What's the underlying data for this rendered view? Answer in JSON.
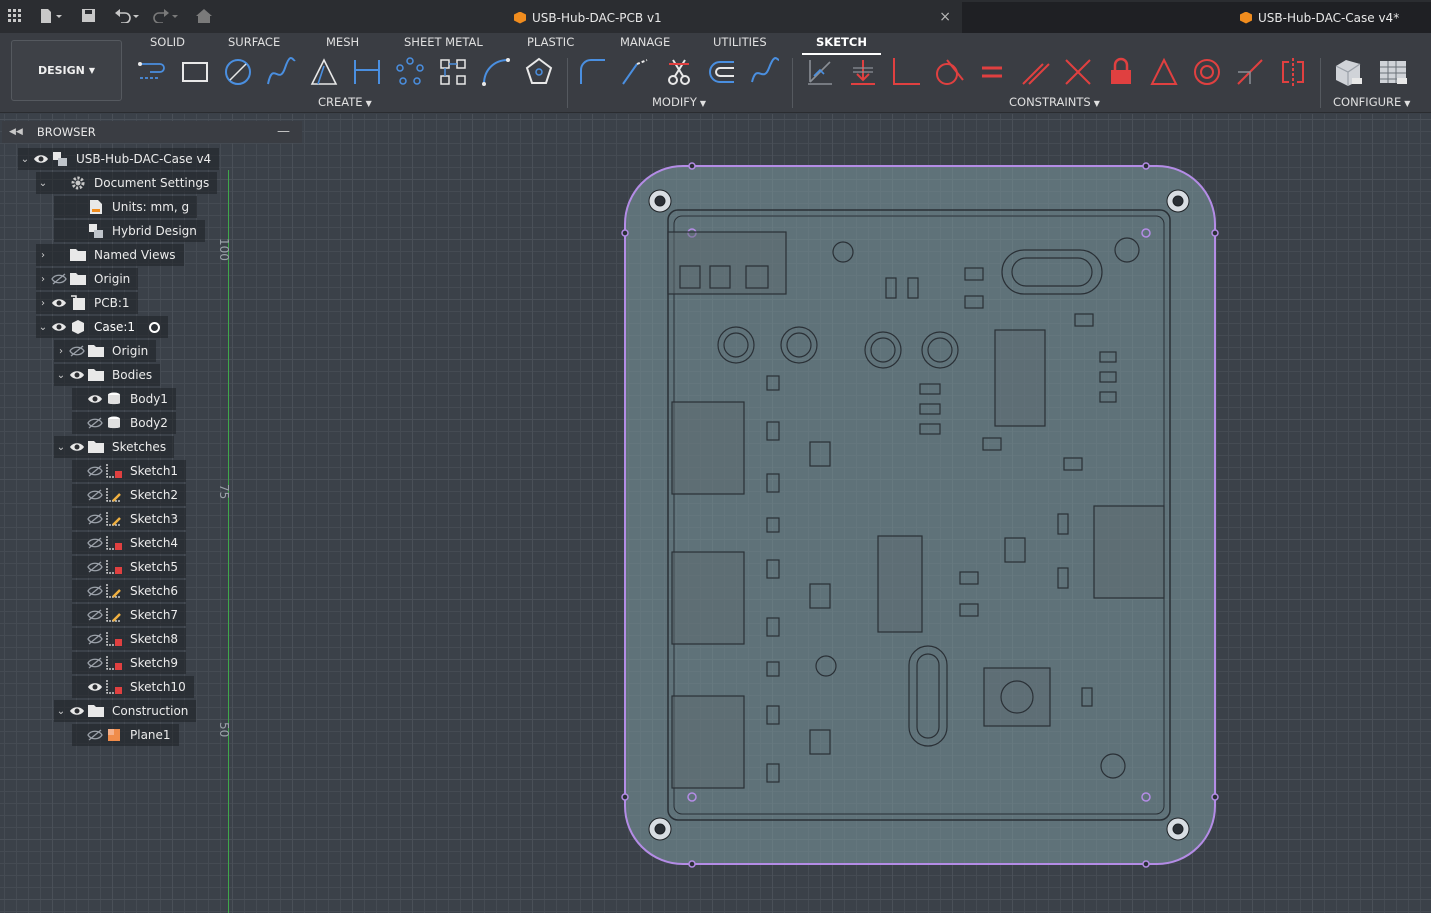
{
  "titlebar": {
    "tabs": [
      {
        "label": "USB-Hub-DAC-PCB v1",
        "close": "×"
      },
      {
        "label": "USB-Hub-DAC-Case v4*"
      }
    ]
  },
  "toolbar": {
    "design_label": "DESIGN",
    "workspace_tabs": [
      "SOLID",
      "SURFACE",
      "MESH",
      "SHEET METAL",
      "PLASTIC",
      "MANAGE",
      "UTILITIES",
      "SKETCH"
    ],
    "active_tab": "SKETCH",
    "groups": {
      "create": "CREATE",
      "modify": "MODIFY",
      "constraints": "CONSTRAINTS",
      "configure": "CONFIGURE"
    }
  },
  "browser": {
    "title": "BROWSER",
    "items": [
      {
        "label": "USB-Hub-DAC-Case v4"
      },
      {
        "label": "Document Settings"
      },
      {
        "label": "Units: mm, g"
      },
      {
        "label": "Hybrid Design"
      },
      {
        "label": "Named Views"
      },
      {
        "label": "Origin"
      },
      {
        "label": "PCB:1"
      },
      {
        "label": "Case:1"
      },
      {
        "label": "Origin"
      },
      {
        "label": "Bodies"
      },
      {
        "label": "Body1"
      },
      {
        "label": "Body2"
      },
      {
        "label": "Sketches"
      },
      {
        "label": "Sketch1"
      },
      {
        "label": "Sketch2"
      },
      {
        "label": "Sketch3"
      },
      {
        "label": "Sketch4"
      },
      {
        "label": "Sketch5"
      },
      {
        "label": "Sketch6"
      },
      {
        "label": "Sketch7"
      },
      {
        "label": "Sketch8"
      },
      {
        "label": "Sketch9"
      },
      {
        "label": "Sketch10"
      },
      {
        "label": "Construction"
      },
      {
        "label": "Plane1"
      }
    ]
  },
  "ruler": {
    "labels": [
      "100",
      "75",
      "50"
    ]
  },
  "colors": {
    "accent_orange": "#f08c1e",
    "sketch_purple": "#b48ce6",
    "axis_green": "#3fa84a"
  }
}
